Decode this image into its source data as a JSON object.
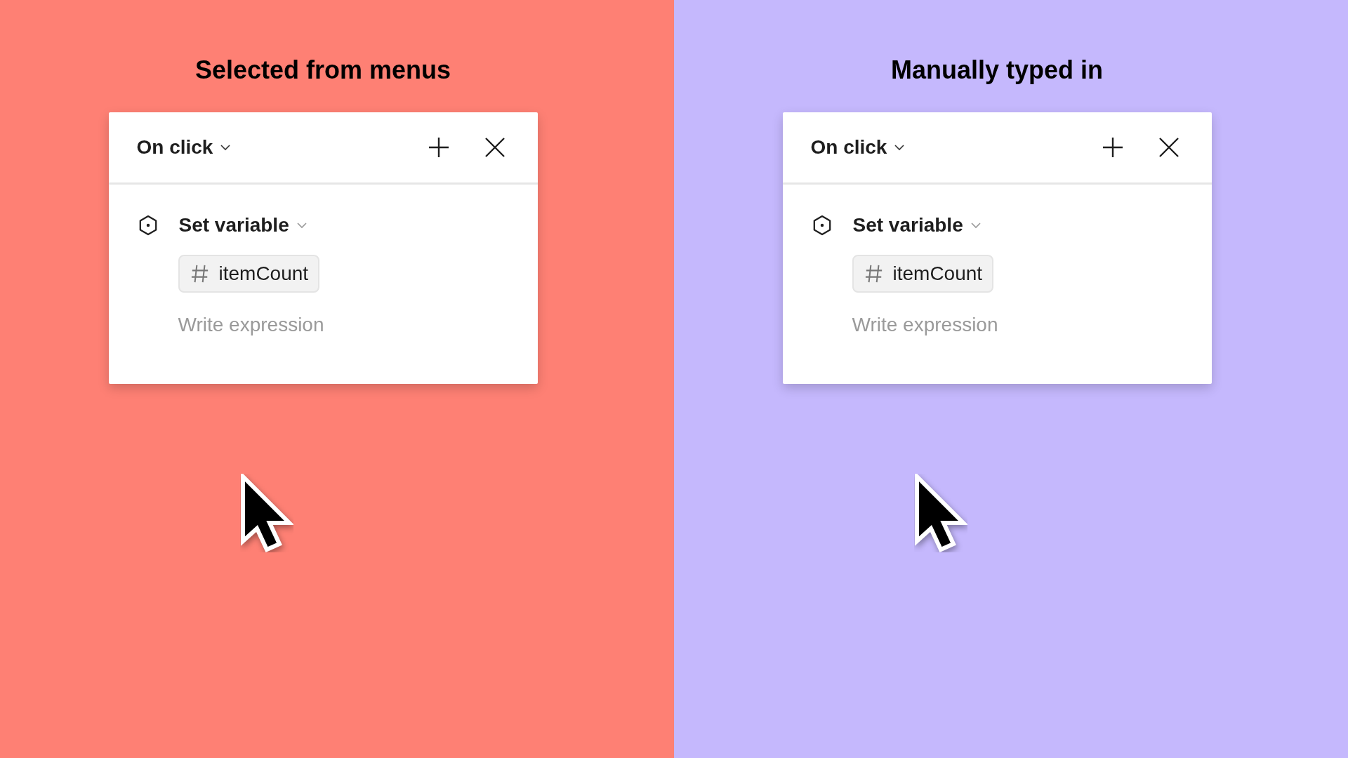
{
  "panels": [
    {
      "title": "Selected from menus",
      "color": "#fe8074",
      "trigger": "On click",
      "action": "Set variable",
      "variable": "itemCount",
      "expression": {
        "placeholder": "Write expression"
      }
    },
    {
      "title": "Manually typed in",
      "color": "#c5b8fd",
      "trigger": "On click",
      "action": "Set variable",
      "variable": "itemCount",
      "expression": {
        "placeholder": "Write expression"
      }
    }
  ]
}
